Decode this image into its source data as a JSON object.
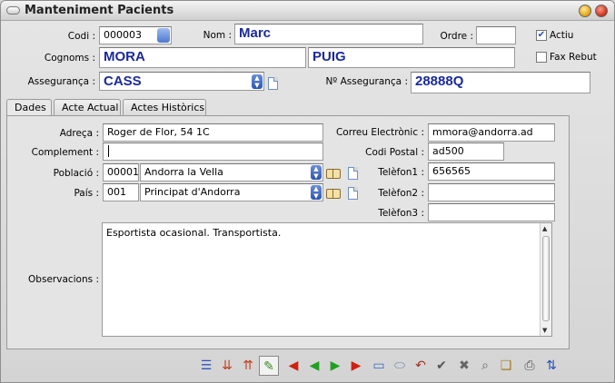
{
  "window": {
    "title": "Manteniment Pacients"
  },
  "header": {
    "codi_label": "Codi :",
    "codi_value": "000003",
    "nom_label": "Nom :",
    "nom_value": "Marc",
    "ordre_label": "Ordre :",
    "ordre_value": "",
    "actiu_label": "Actiu",
    "actiu_checked": true,
    "cognoms_label": "Cognoms :",
    "cognom1_value": "MORA",
    "cognom2_value": "PUIG",
    "fax_rebut_label": "Fax Rebut",
    "fax_rebut_checked": false,
    "asseguranca_label": "Assegurança :",
    "asseguranca_value": "CASS",
    "num_asseguranca_label": "Nº Assegurança :",
    "num_asseguranca_value": "28888Q"
  },
  "tabs": [
    {
      "label": "Dades",
      "active": true
    },
    {
      "label": "Acte Actual",
      "active": false
    },
    {
      "label": "Actes Històrics",
      "active": false
    }
  ],
  "dades": {
    "adreca_label": "Adreça :",
    "adreca_value": "Roger de Flor, 54 1C",
    "complement_label": "Complement :",
    "complement_value": "",
    "poblacio_label": "Població :",
    "poblacio_code": "00001",
    "poblacio_value": "Andorra la Vella",
    "pais_label": "País :",
    "pais_code": "001",
    "pais_value": "Principat d'Andorra",
    "correu_label": "Correu Electrònic :",
    "correu_value": "mmora@andorra.ad",
    "codi_postal_label": "Codi Postal :",
    "codi_postal_value": "ad500",
    "telefon1_label": "Telèfon1 :",
    "telefon1_value": "656565",
    "telefon2_label": "Telèfon2 :",
    "telefon2_value": "",
    "telefon3_label": "Telèfon3 :",
    "telefon3_value": "",
    "observacions_label": "Observacions :",
    "observacions_value": "Esportista ocasional. Transportista."
  },
  "toolbar_icons": [
    "list-icon",
    "import-icon",
    "export-icon",
    "edit-icon",
    "first-record-icon",
    "previous-record-icon",
    "next-record-icon",
    "last-record-icon",
    "new-record-icon",
    "eraser-icon",
    "undo-icon",
    "confirm-icon",
    "cancel-icon",
    "search-icon",
    "browse-icon",
    "print-icon",
    "sort-icon"
  ],
  "colors": {
    "accent_text": "#1a2a9a",
    "close": "#cc2a18",
    "minimize": "#e3a10a"
  }
}
